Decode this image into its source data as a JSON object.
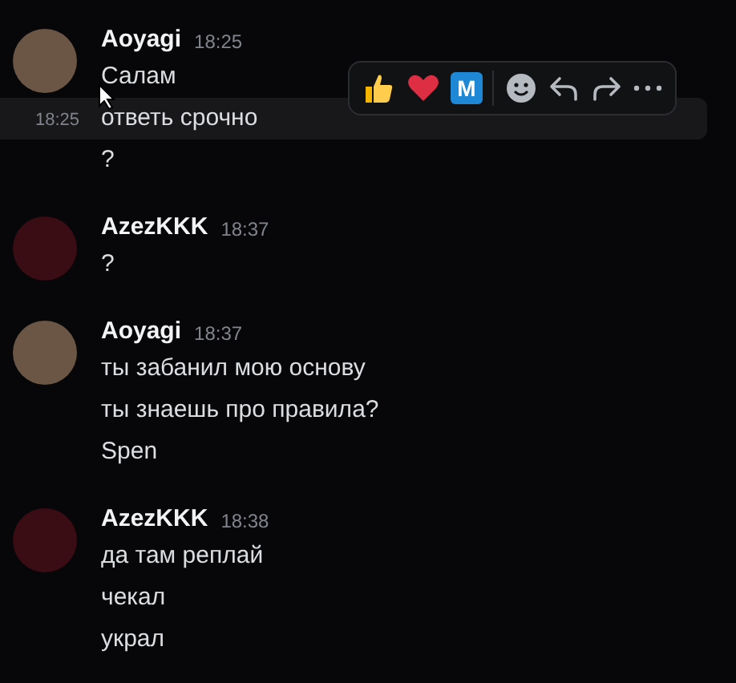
{
  "messages": [
    {
      "author": "Aoyagi",
      "time": "18:25",
      "color": "#6b5646",
      "lines": [
        {
          "text": "Салам",
          "highlighted": false
        },
        {
          "text": "ответь срочно",
          "highlighted": true,
          "time": "18:25"
        },
        {
          "text": "?",
          "highlighted": false
        }
      ]
    },
    {
      "author": "AzezKKK",
      "time": "18:37",
      "color": "#3a0c14",
      "lines": [
        {
          "text": "?",
          "highlighted": false
        }
      ]
    },
    {
      "author": "Aoyagi",
      "time": "18:37",
      "color": "#6b5646",
      "lines": [
        {
          "text": "ты забанил мою основу",
          "highlighted": false
        },
        {
          "text": "ты знаешь про правила?",
          "highlighted": false
        },
        {
          "text": "Spen",
          "highlighted": false
        }
      ]
    },
    {
      "author": "AzezKKK",
      "time": "18:38",
      "color": "#3a0c14",
      "lines": [
        {
          "text": "да там реплай",
          "highlighted": false
        },
        {
          "text": "чекал",
          "highlighted": false
        },
        {
          "text": "украл",
          "highlighted": false
        }
      ]
    }
  ],
  "message_actions": [
    {
      "kind": "thumbs"
    },
    {
      "kind": "heart"
    },
    {
      "kind": "app",
      "label": "M"
    },
    {
      "kind": "divider"
    },
    {
      "kind": "emoji"
    },
    {
      "kind": "reply"
    },
    {
      "kind": "forward"
    },
    {
      "kind": "more"
    }
  ]
}
